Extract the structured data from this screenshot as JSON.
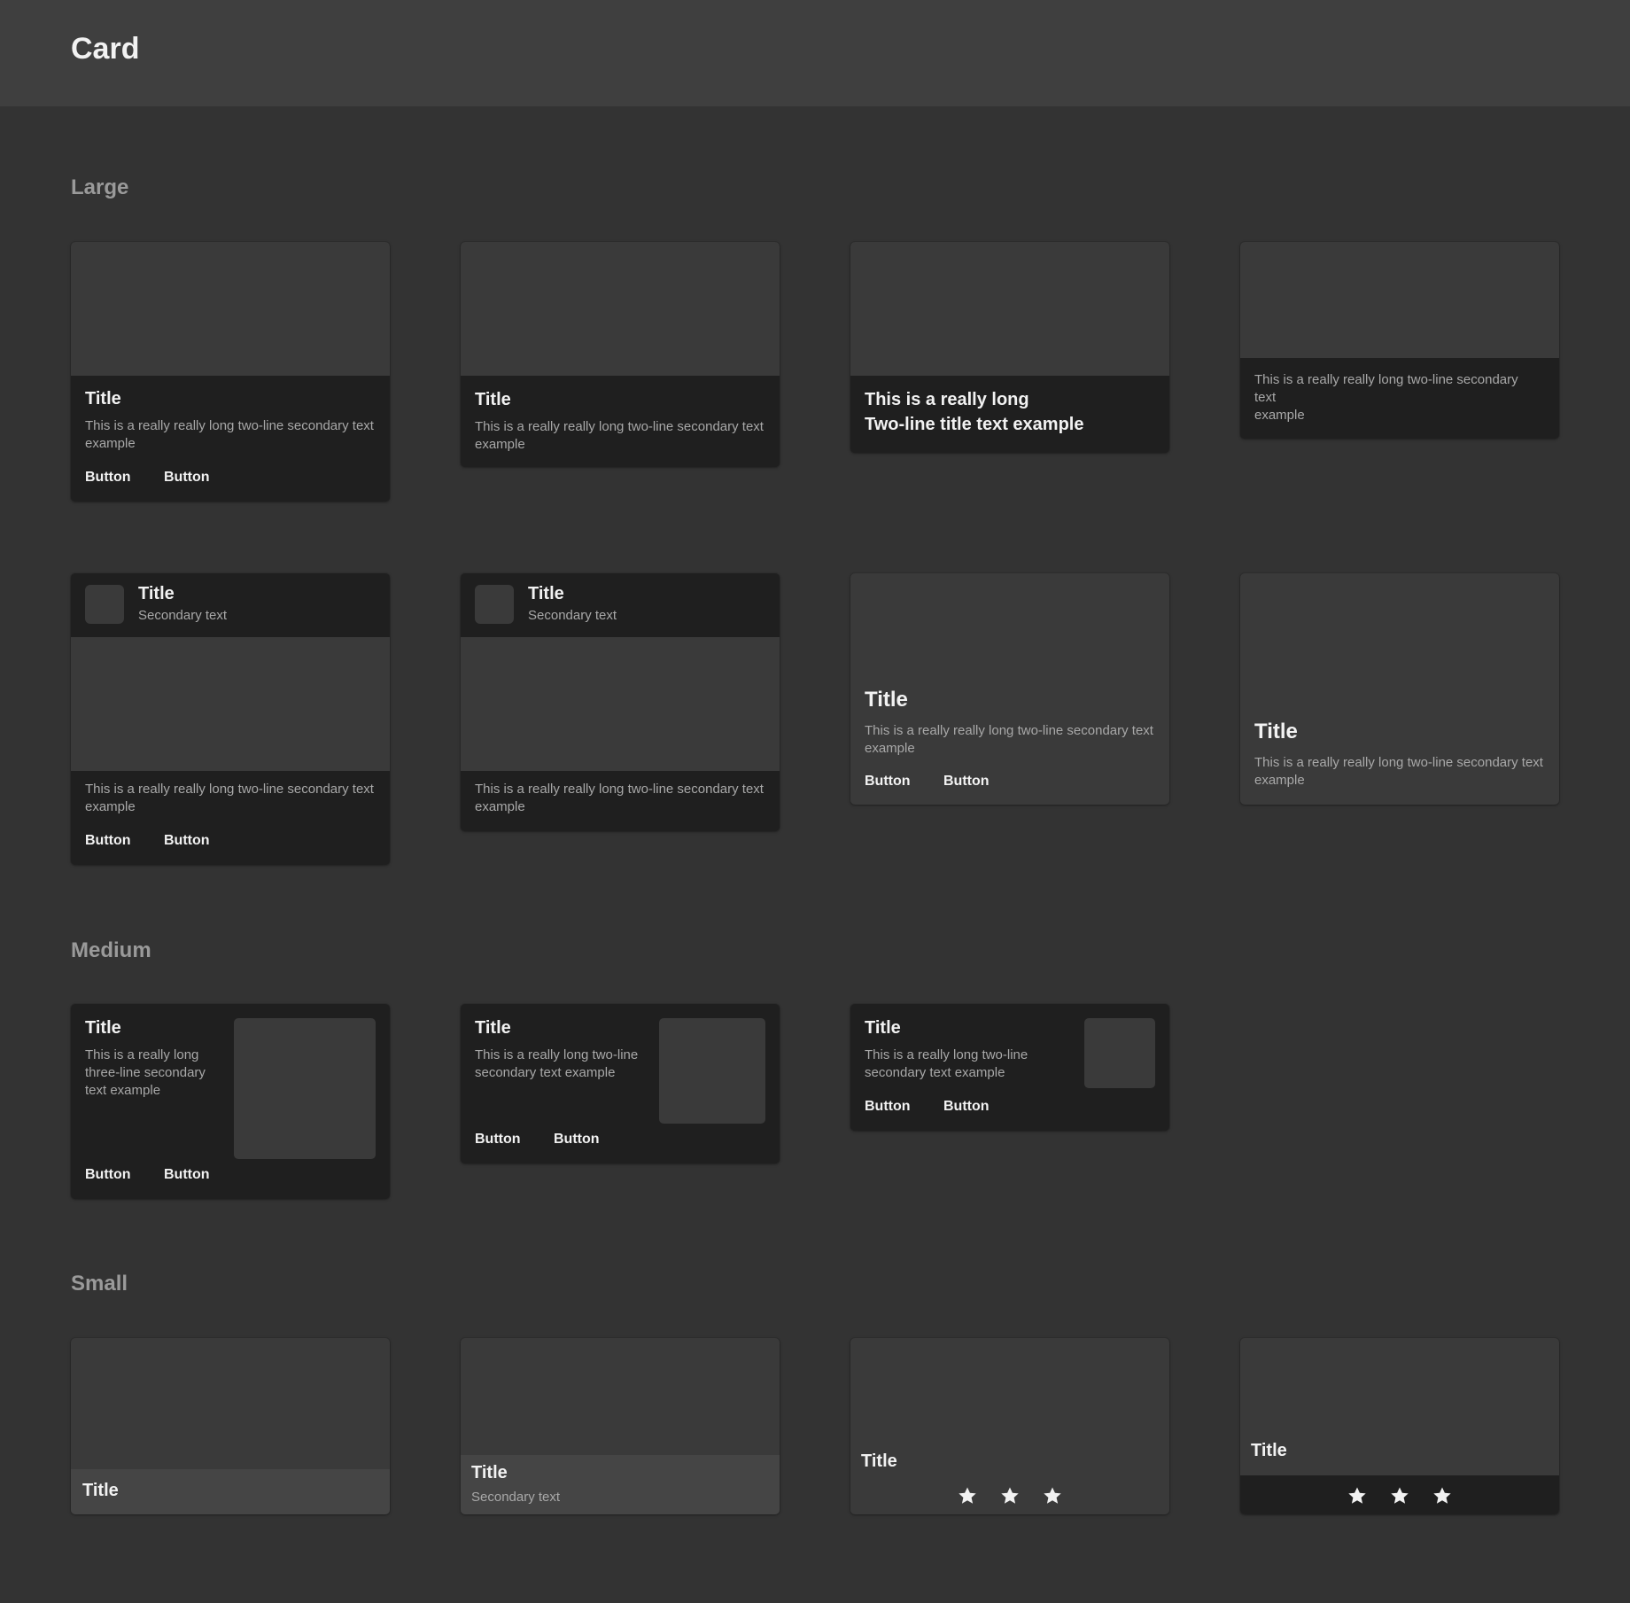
{
  "page": {
    "title": "Card"
  },
  "sections": {
    "large": "Large",
    "medium": "Medium",
    "small": "Small"
  },
  "large": [
    {
      "title": "Title",
      "secondary": "This is a really really long two-line secondary text example",
      "button1": "Button",
      "button2": "Button"
    },
    {
      "title": "Title",
      "secondary": "This is a really really long two-line secondary text example"
    },
    {
      "title_line1": "This is a really long",
      "title_line2": "Two-line title text example"
    },
    {
      "secondary_line1": "This is a really really long two-line secondary",
      "secondary_line2": "text",
      "secondary_line3": "example"
    },
    {
      "title": "Title",
      "header_secondary": "Secondary text",
      "secondary": "This is a really really long two-line secondary text example",
      "button1": "Button",
      "button2": "Button"
    },
    {
      "title": "Title",
      "header_secondary": "Secondary text",
      "secondary": "This is a really really long two-line secondary text example"
    },
    {
      "title": "Title",
      "secondary": "This is a really really long two-line secondary text example",
      "button1": "Button",
      "button2": "Button"
    },
    {
      "title": "Title",
      "secondary": "This is a really really long two-line secondary text example"
    }
  ],
  "medium": [
    {
      "title": "Title",
      "secondary": "This is a really long three-line secondary text example",
      "button1": "Button",
      "button2": "Button"
    },
    {
      "title": "Title",
      "secondary": "This is a really long two-line secondary text example",
      "button1": "Button",
      "button2": "Button"
    },
    {
      "title": "Title",
      "secondary": "This is a really long two-line secondary text example",
      "button1": "Button",
      "button2": "Button"
    }
  ],
  "small": [
    {
      "title": "Title"
    },
    {
      "title": "Title",
      "secondary": "Secondary text"
    },
    {
      "title": "Title",
      "stars": [
        "star-icon",
        "star-icon",
        "star-icon"
      ]
    },
    {
      "title": "Title",
      "stars": [
        "star-icon",
        "star-icon",
        "star-icon"
      ]
    }
  ],
  "colors": {
    "page_bg": "#333333",
    "header_bg": "#3f3f3f",
    "card_media": "#3a3a3a",
    "card_panel": "#1f1f1f",
    "card_panel_light": "#454545",
    "text_primary": "#f2f2f2",
    "text_secondary": "#a8a8a8",
    "section_label": "#9a9a9a"
  }
}
